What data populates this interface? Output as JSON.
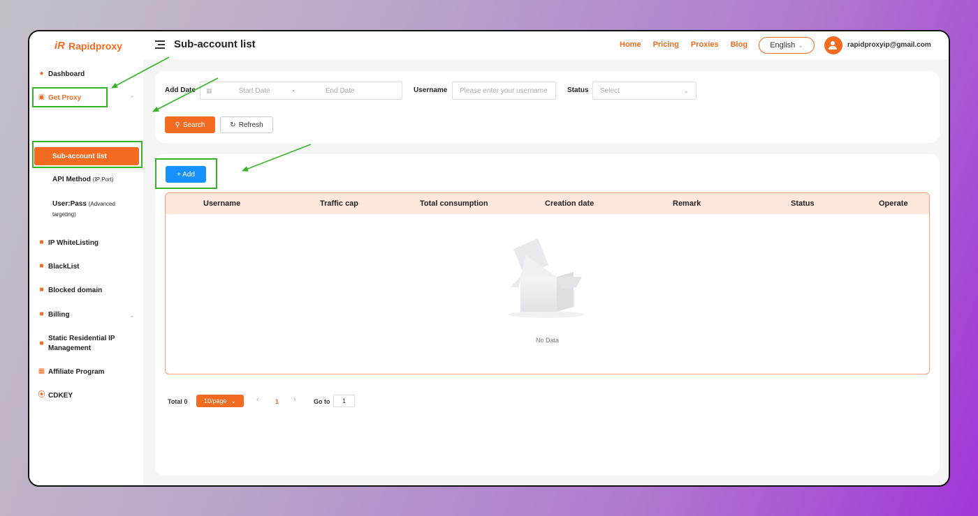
{
  "brand": {
    "logo_icon": "iR",
    "name": "Rapidproxy",
    "accent": "#f26b21",
    "highlight": "#35b526",
    "primary": "#1890ff"
  },
  "header": {
    "title": "Sub-account list",
    "nav": [
      "Home",
      "Pricing",
      "Proxies",
      "Blog"
    ],
    "language": "English",
    "user_email": "rapidproxyip@gmail.com"
  },
  "sidebar": {
    "dashboard": "Dashboard",
    "get_proxy": "Get Proxy",
    "sub_account": "Sub-account list",
    "api_method": "API Method",
    "api_method_note": "(IP:Port)",
    "userpass": "User:Pass",
    "userpass_note": "(Advanced targeting)",
    "whitelisting": "IP WhiteListing",
    "blacklist": "BlackList",
    "blocked_domain": "Blocked domain",
    "billing": "Billing",
    "static_residential": "Static Residential IP Management",
    "affiliate": "Affiliate Program",
    "cdkey": "CDKEY"
  },
  "filters": {
    "add_date_label": "Add Date",
    "start_date_placeholder": "Start Date",
    "date_separator": "-",
    "end_date_placeholder": "End Date",
    "username_label": "Username",
    "username_placeholder": "Please enter your username",
    "status_label": "Status",
    "status_placeholder": "Select",
    "search_button": "Search",
    "refresh_button": "Refresh"
  },
  "table": {
    "add_button": "+ Add",
    "columns": [
      "Username",
      "Traffic cap",
      "Total consumption",
      "Creation date",
      "Remark",
      "Status",
      "Operate"
    ],
    "rows": [],
    "empty_text": "No Data"
  },
  "pagination": {
    "total_label": "Total 0",
    "page_size": "10/page",
    "current_page": "1",
    "goto_label": "Go to",
    "goto_value": "1"
  }
}
